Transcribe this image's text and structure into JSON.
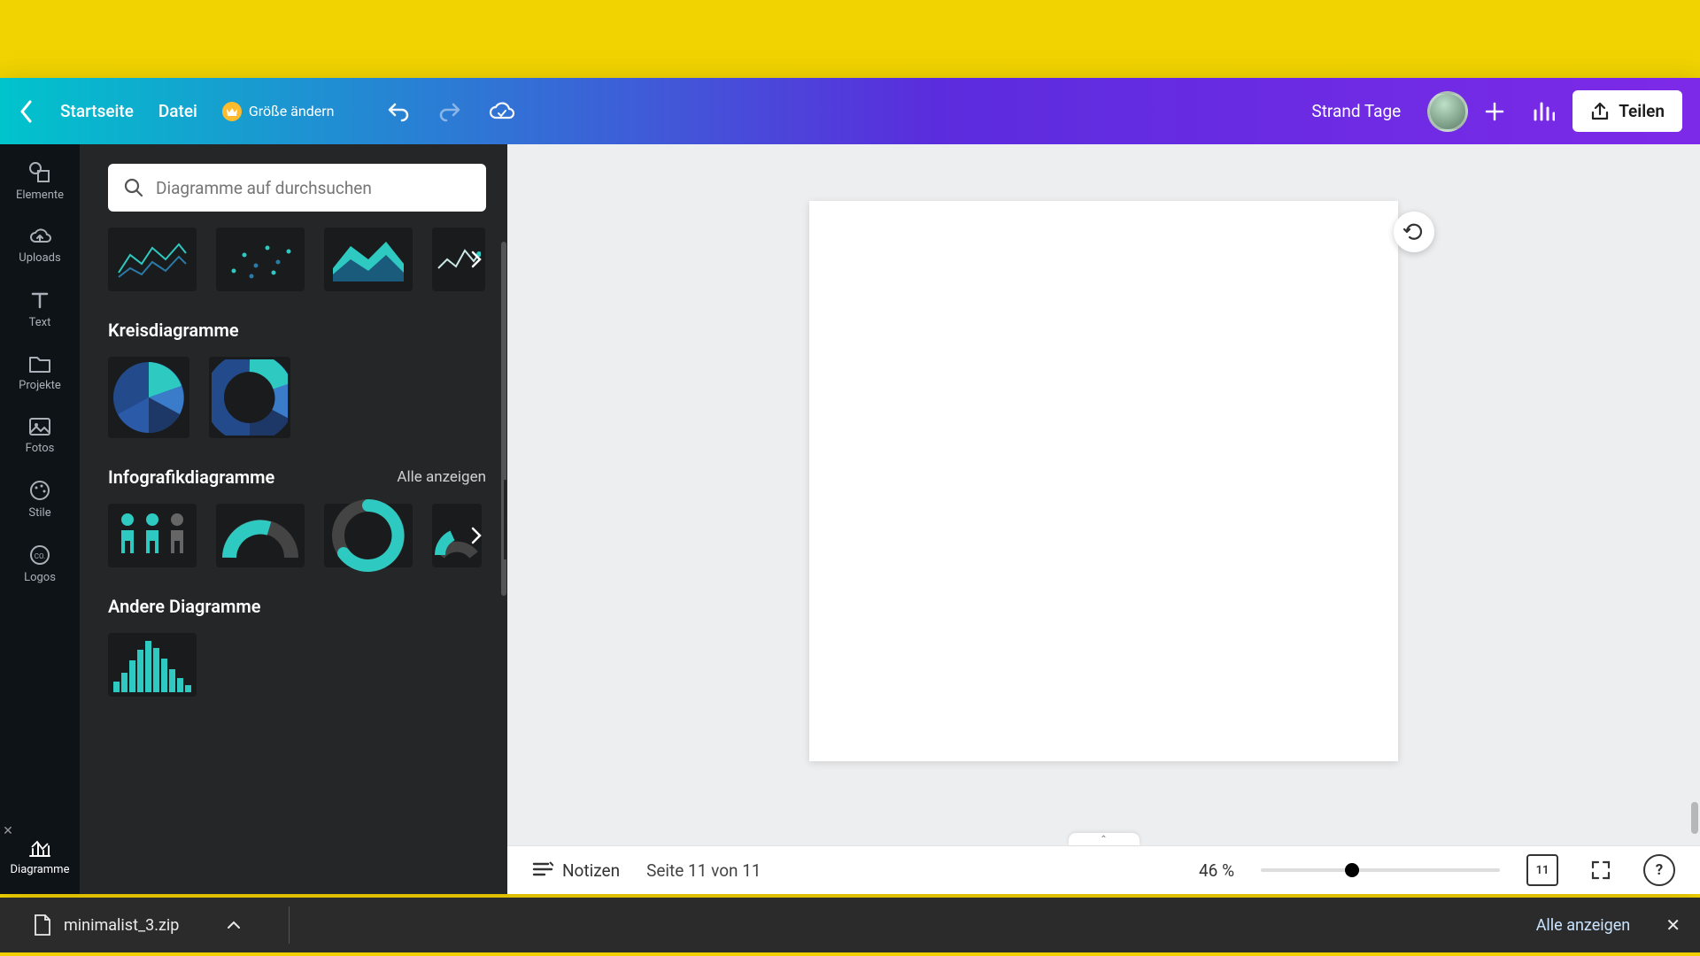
{
  "topbar": {
    "home": "Startseite",
    "file": "Datei",
    "resize": "Größe ändern",
    "doc_title": "Strand Tage",
    "share": "Teilen"
  },
  "rail": {
    "elements": "Elemente",
    "uploads": "Uploads",
    "text": "Text",
    "projects": "Projekte",
    "photos": "Fotos",
    "styles": "Stile",
    "logos": "Logos",
    "diagrams": "Diagramme"
  },
  "panel": {
    "search_placeholder": "Diagramme auf durchsuchen",
    "section_pie": "Kreisdiagramme",
    "section_info": "Infografikdiagramme",
    "see_all": "Alle anzeigen",
    "section_other": "Andere Diagramme"
  },
  "status": {
    "notes": "Notizen",
    "page_label": "Seite 11 von 11",
    "zoom": "46 %",
    "grid_count": "11"
  },
  "downloads": {
    "filename": "minimalist_3.zip",
    "show_all": "Alle anzeigen"
  },
  "colors": {
    "teal": "#2ec9c0",
    "blue": "#2a5aa8",
    "dark": "#252627"
  }
}
